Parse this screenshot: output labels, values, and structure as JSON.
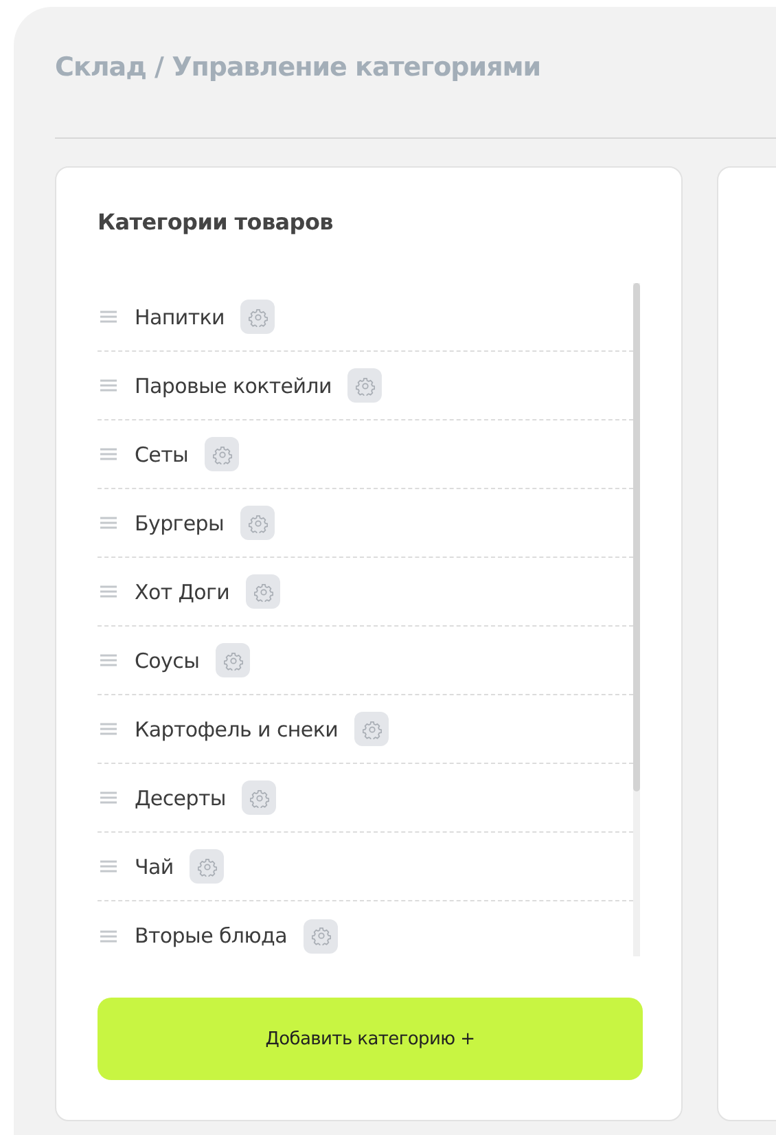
{
  "breadcrumb": "Склад / Управление категориями",
  "panel": {
    "title": "Категории товаров"
  },
  "categories": [
    {
      "name": "Напитки"
    },
    {
      "name": "Паровые коктейли"
    },
    {
      "name": "Сеты"
    },
    {
      "name": "Бургеры"
    },
    {
      "name": "Хот Доги"
    },
    {
      "name": "Соусы"
    },
    {
      "name": "Картофель и снеки"
    },
    {
      "name": "Десерты"
    },
    {
      "name": "Чай"
    },
    {
      "name": "Вторые блюда"
    }
  ],
  "add_button": "Добавить категорию +"
}
